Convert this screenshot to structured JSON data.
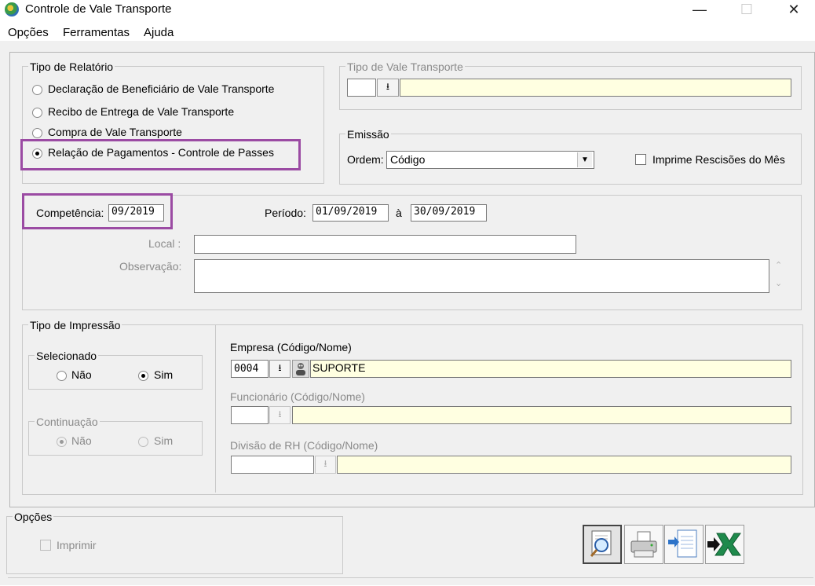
{
  "window": {
    "title": "Controle de Vale Transporte",
    "minimize": "—",
    "maximize": "☐",
    "close": "✕"
  },
  "menu": [
    "Opções",
    "Ferramentas",
    "Ajuda"
  ],
  "tipo_relatorio": {
    "legend": "Tipo de Relatório",
    "options": [
      "Declaração de Beneficiário de Vale Transporte",
      "Recibo de Entrega de Vale Transporte",
      "Compra de Vale Transporte",
      "Relação de Pagamentos - Controle de Passes"
    ],
    "selected_index": 3
  },
  "tipo_vale": {
    "legend": "Tipo de Vale Transporte",
    "code": "",
    "name": "",
    "lookup": "⭳"
  },
  "emissao": {
    "legend": "Emissão",
    "ordem_label": "Ordem:",
    "ordem_value": "Código",
    "imprime_rescisoes_label": "Imprime Rescisões do Mês",
    "imprime_rescisoes_checked": false
  },
  "competencia": {
    "label": "Competência:",
    "value": "09/2019"
  },
  "periodo": {
    "label": "Período:",
    "from": "01/09/2019",
    "sep": "à",
    "to": "30/09/2019"
  },
  "local": {
    "label": "Local :",
    "value": ""
  },
  "observacao": {
    "label": "Observação:",
    "value": ""
  },
  "tipo_impressao": {
    "legend": "Tipo de Impressão",
    "selecionado": {
      "legend": "Selecionado",
      "nao": "Não",
      "sim": "Sim",
      "selected": "sim"
    },
    "continuacao": {
      "legend": "Continuação",
      "nao": "Não",
      "sim": "Sim",
      "selected": "nao"
    }
  },
  "empresa": {
    "label": "Empresa (Código/Nome)",
    "code": "0004",
    "name": "SUPORTE",
    "lookup": "⭳"
  },
  "funcionario": {
    "label": "Funcionário (Código/Nome)",
    "code": "",
    "name": "",
    "lookup": "⭳"
  },
  "divisao": {
    "label": "Divisão de RH (Código/Nome)",
    "code": "",
    "name": "",
    "lookup": "⭳"
  },
  "opcoes": {
    "legend": "Opções",
    "imprimir_label": "Imprimir",
    "imprimir_checked": false
  },
  "colors": {
    "highlight": "#9b4ba3",
    "field_yellow": "#ffffe1"
  }
}
